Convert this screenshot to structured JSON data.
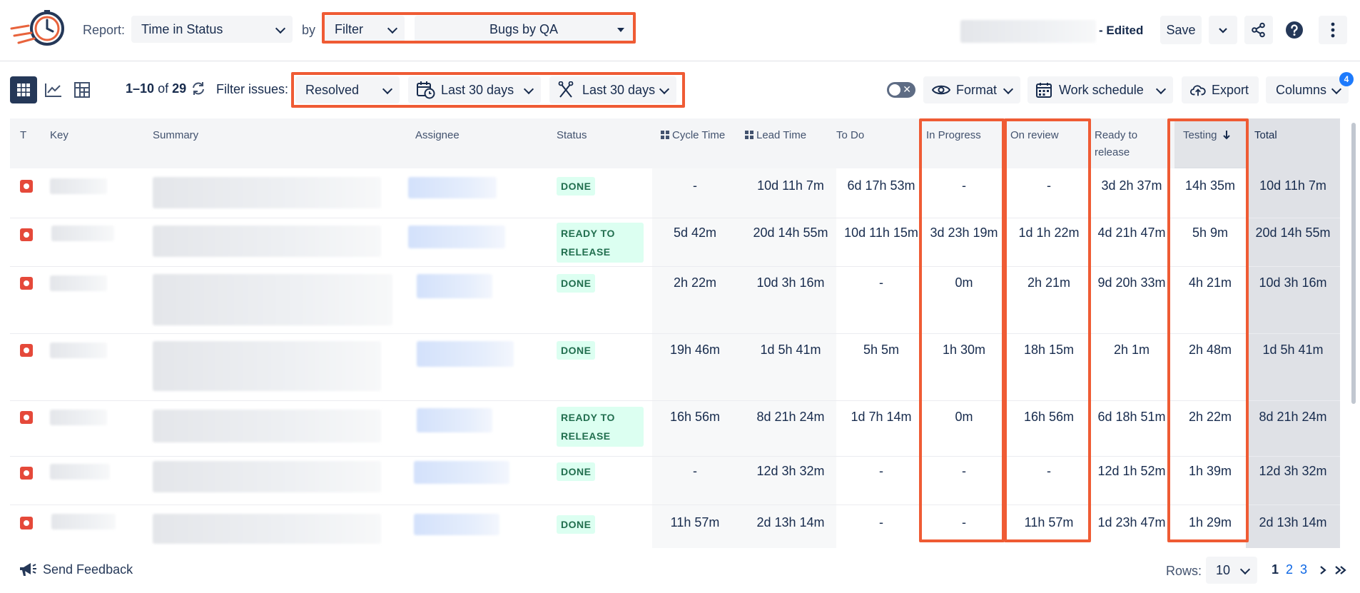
{
  "header": {
    "report_label": "Report:",
    "report_value": "Time in Status",
    "by_label": "by",
    "filter_type": "Filter",
    "filter_value": "Bugs by QA",
    "edited_label": "- Edited",
    "save_label": "Save"
  },
  "toolbar": {
    "range_text": "1–10",
    "of_text": "of",
    "total_count": "29",
    "filter_issues_label": "Filter issues:",
    "resolution_value": "Resolved",
    "created_range": "Last 30 days",
    "resolved_range": "Last 30 days",
    "format_label": "Format",
    "work_schedule_label": "Work schedule",
    "export_label": "Export",
    "columns_label": "Columns",
    "columns_badge": "4"
  },
  "table": {
    "headers": {
      "type": "T",
      "key": "Key",
      "summary": "Summary",
      "assignee": "Assignee",
      "status": "Status",
      "cycle_time": "Cycle Time",
      "lead_time": "Lead Time",
      "to_do": "To Do",
      "in_progress": "In Progress",
      "on_review": "On review",
      "ready_to_release_line1": "Ready to",
      "ready_to_release_line2": "release",
      "testing": "Testing",
      "total": "Total"
    },
    "rows": [
      {
        "status": "DONE",
        "cycle": "-",
        "lead": "10d 11h 7m",
        "todo": "6d 17h 53m",
        "inprogress": "-",
        "review": "-",
        "ready": "3d 2h 37m",
        "testing": "14h 35m",
        "total": "10d 11h 7m"
      },
      {
        "status1": "READY TO",
        "status2": "RELEASE",
        "cycle": "5d 42m",
        "lead": "20d 14h 55m",
        "todo": "10d 11h 15m",
        "inprogress": "3d 23h 19m",
        "review": "1d 1h 22m",
        "ready": "4d 21h 47m",
        "testing": "5h 9m",
        "total": "20d 14h 55m"
      },
      {
        "status": "DONE",
        "cycle": "2h 22m",
        "lead": "10d 3h 16m",
        "todo": "-",
        "inprogress": "0m",
        "review": "2h 21m",
        "ready": "9d 20h 33m",
        "testing": "4h 21m",
        "total": "10d 3h 16m"
      },
      {
        "status": "DONE",
        "cycle": "19h 46m",
        "lead": "1d 5h 41m",
        "todo": "5h 5m",
        "inprogress": "1h 30m",
        "review": "18h 15m",
        "ready": "2h 1m",
        "testing": "2h 48m",
        "total": "1d 5h 41m"
      },
      {
        "status1": "READY TO",
        "status2": "RELEASE",
        "cycle": "16h 56m",
        "lead": "8d 21h 24m",
        "todo": "1d 7h 14m",
        "inprogress": "0m",
        "review": "16h 56m",
        "ready": "6d 18h 51m",
        "testing": "2h 22m",
        "total": "8d 21h 24m"
      },
      {
        "status": "DONE",
        "cycle": "-",
        "lead": "12d 3h 32m",
        "todo": "-",
        "inprogress": "-",
        "review": "-",
        "ready": "12d 1h 52m",
        "testing": "1h 39m",
        "total": "12d 3h 32m"
      },
      {
        "status": "DONE",
        "cycle": "11h 57m",
        "lead": "2d 13h 14m",
        "todo": "-",
        "inprogress": "-",
        "review": "11h 57m",
        "ready": "1d 23h 47m",
        "testing": "1h 29m",
        "total": "2d 13h 14m"
      }
    ]
  },
  "footer": {
    "feedback_label": "Send Feedback",
    "rows_label": "Rows:",
    "rows_value": "10",
    "pages": [
      "1",
      "2",
      "3"
    ]
  },
  "colors": {
    "accent_highlight": "#ef5b34",
    "done_text": "#216e4e",
    "done_bg": "#dcfff1",
    "bug_icon": "#e5493a",
    "link": "#0c66e4"
  },
  "icons": [
    "app-logo-icon",
    "chevron-down-icon",
    "share-icon",
    "help-icon",
    "more-vertical-icon",
    "grid-view-icon",
    "chart-view-icon",
    "pivot-view-icon",
    "refresh-icon",
    "calendar-clock-icon",
    "resolved-icon",
    "eye-icon",
    "calendar-icon",
    "cloud-upload-icon",
    "bug-icon",
    "sort-down-icon",
    "megaphone-icon",
    "first-page-icon",
    "last-page-icon"
  ]
}
